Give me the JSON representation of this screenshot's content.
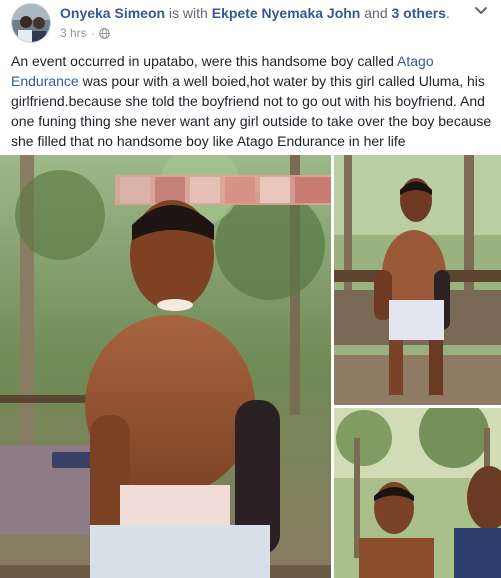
{
  "post": {
    "author": "Onyeka Simeon",
    "with_text": " is with ",
    "tagged": "Ekpete Nyemaka John",
    "and_text": " and ",
    "others": "3 others",
    "period": ".",
    "time": "3 hrs",
    "separator": "·",
    "audience_icon": "globe-icon",
    "more_icon": "chevron-down-icon",
    "text_part1": "An event occurred in upatabo, were this handsome boy called ",
    "text_link": "Atago Endurance",
    "text_part2": " was pour with a well boied,hot water by this girl called Uluma, his girlfriend.because she told the boyfriend not to go out with his boyfriend. And one funing thing she never want any girl outside to take over the boy because she filled that no handsome boy like Atago Endurance in her life"
  },
  "photos": [
    {
      "name": "photo-main"
    },
    {
      "name": "photo-top-right"
    },
    {
      "name": "photo-bottom-right"
    }
  ],
  "colors": {
    "link": "#365899",
    "meta": "#90949c",
    "text": "#1d2129"
  }
}
